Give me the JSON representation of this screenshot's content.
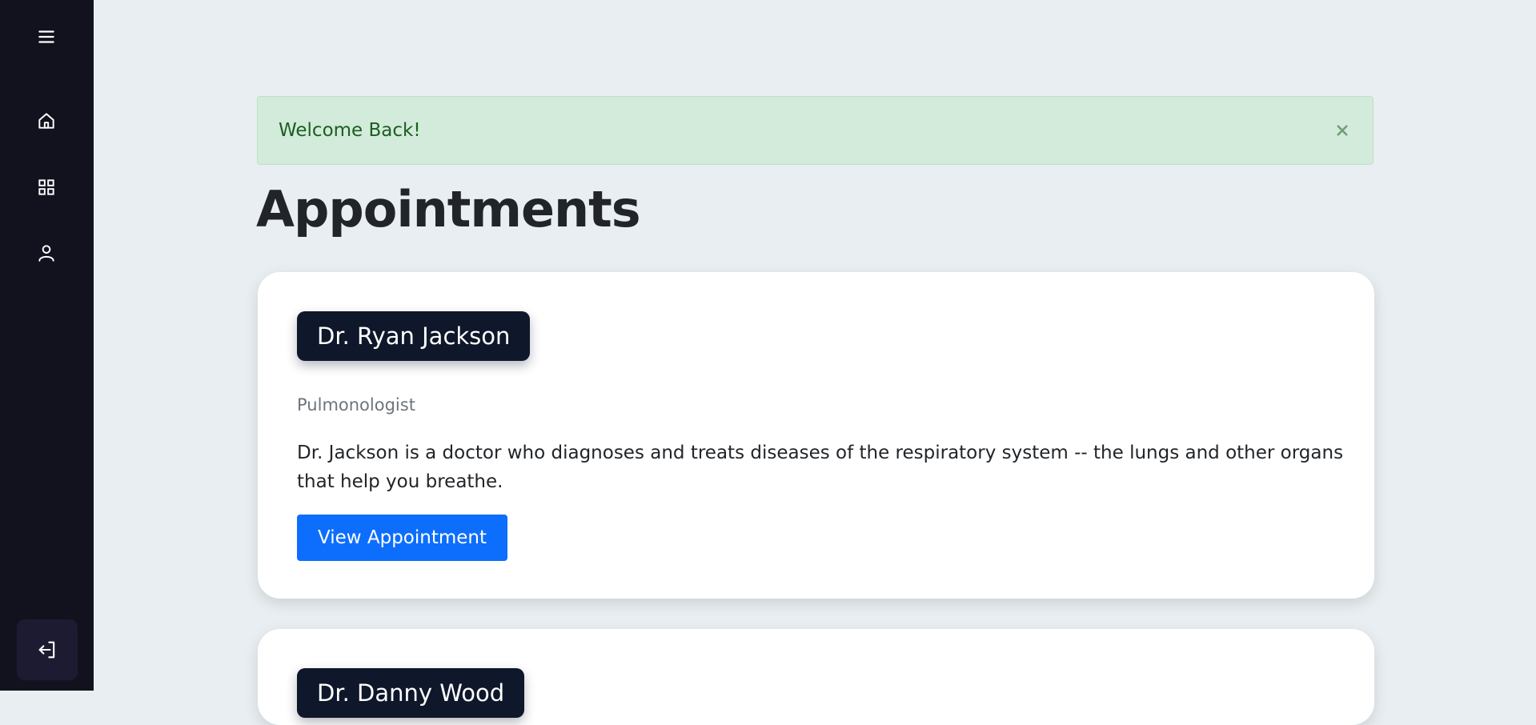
{
  "sidebar": {
    "icons": [
      "menu-icon",
      "home-icon",
      "grid-icon",
      "user-icon"
    ],
    "logout_icon": "logout-icon",
    "background": "#12121f"
  },
  "alert": {
    "message": "Welcome Back!",
    "close_symbol": "✖",
    "background": "#d3ebda"
  },
  "page": {
    "title": "Appointments"
  },
  "appointments": [
    {
      "doctor": "Dr. Ryan Jackson",
      "specialty": "Pulmonologist",
      "description": "Dr. Jackson is a doctor who diagnoses and treats diseases of the respiratory system -- the lungs and other organs that help you breathe.",
      "button_label": "View Appointment"
    },
    {
      "doctor": "Dr. Danny Wood"
    }
  ],
  "colors": {
    "accent": "#0d6efd",
    "name_badge": "#0f172a"
  }
}
